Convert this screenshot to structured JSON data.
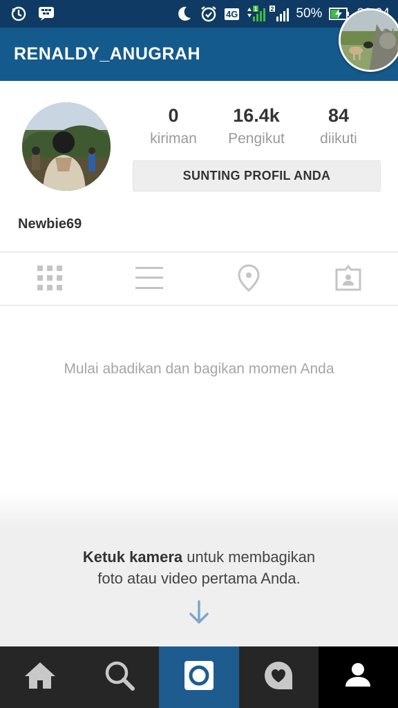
{
  "status_bar": {
    "battery": "50%",
    "time": "23.04",
    "network": "4G",
    "sim1": "1",
    "sim2": "2",
    "icons": [
      "sync-icon",
      "bbm-icon",
      "moon-icon",
      "alarm-icon",
      "signal-icon",
      "battery-charging-icon"
    ]
  },
  "header": {
    "title": "RENALDY_ANUGRAH"
  },
  "profile": {
    "username": "Newbie69",
    "stats": [
      {
        "value": "0",
        "label": "kiriman"
      },
      {
        "value": "16.4k",
        "label": "Pengikut"
      },
      {
        "value": "84",
        "label": "diikuti"
      }
    ],
    "edit_label": "SUNTING PROFIL ANDA"
  },
  "view_tabs": [
    "grid-icon",
    "list-icon",
    "location-pin-icon",
    "tagged-photos-icon"
  ],
  "empty_state": {
    "message": "Mulai abadikan dan bagikan momen Anda"
  },
  "cta": {
    "bold": "Ketuk kamera",
    "rest_line1": " untuk membagikan",
    "line2": "foto atau video pertama Anda."
  },
  "bottom_nav": [
    "home-icon",
    "search-icon",
    "camera-icon",
    "activity-heart-icon",
    "profile-icon"
  ],
  "colors": {
    "status_bar": "#0f3a63",
    "app_bar": "#145a8d",
    "nav_bg": "#262626",
    "camera_active": "#1e5c8f",
    "profile_active": "#000000",
    "arrow": "#7fa6c8"
  }
}
